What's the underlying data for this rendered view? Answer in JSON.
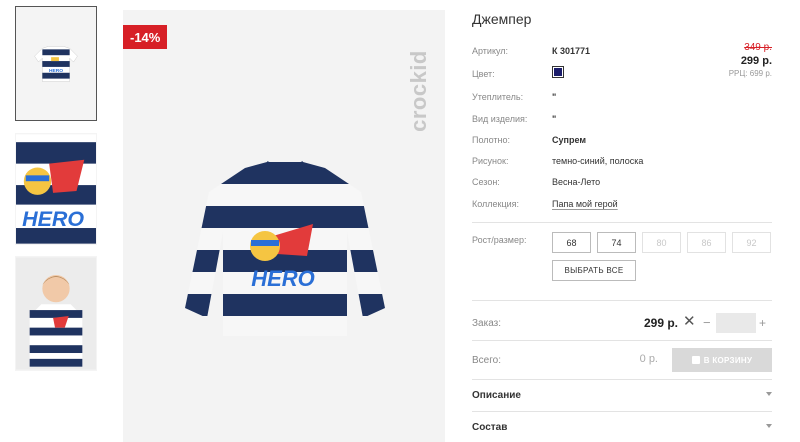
{
  "product": {
    "discount_badge": "-14%",
    "brand": "crockid",
    "title": "Джемпер"
  },
  "price": {
    "old": "349 р.",
    "current": "299 р.",
    "rrc": "РРЦ: 699 р."
  },
  "specs": [
    {
      "label": "Артикул:",
      "value": "К 301771"
    },
    {
      "label": "Цвет:",
      "value": ""
    },
    {
      "label": "Утеплитель:",
      "value": "\""
    },
    {
      "label": "Вид изделия:",
      "value": "\""
    },
    {
      "label": "Полотно:",
      "value": "Супрем"
    },
    {
      "label": "Рисунок:",
      "value": "темно-синий, полоска"
    },
    {
      "label": "Сезон:",
      "value": "Весна-Лето"
    },
    {
      "label": "Коллекция:",
      "value": "Папа мой герой"
    }
  ],
  "color_swatch": "#1b1d6b",
  "sizes": {
    "label": "Рост/размер:",
    "options": [
      {
        "value": "68",
        "available": true
      },
      {
        "value": "74",
        "available": true
      },
      {
        "value": "80",
        "available": false
      },
      {
        "value": "86",
        "available": false
      },
      {
        "value": "92",
        "available": false
      }
    ],
    "select_all": "ВЫБРАТЬ ВСЕ"
  },
  "order": {
    "label": "Заказ:",
    "price": "299 р.",
    "clear": "✕",
    "minus": "−",
    "plus": "+",
    "quantity": ""
  },
  "total": {
    "label": "Всего:",
    "value": "0 р.",
    "cart_button": "В КОРЗИНУ"
  },
  "accordions": [
    {
      "title": "Описание"
    },
    {
      "title": "Состав"
    }
  ],
  "shirt_print": "HERO"
}
